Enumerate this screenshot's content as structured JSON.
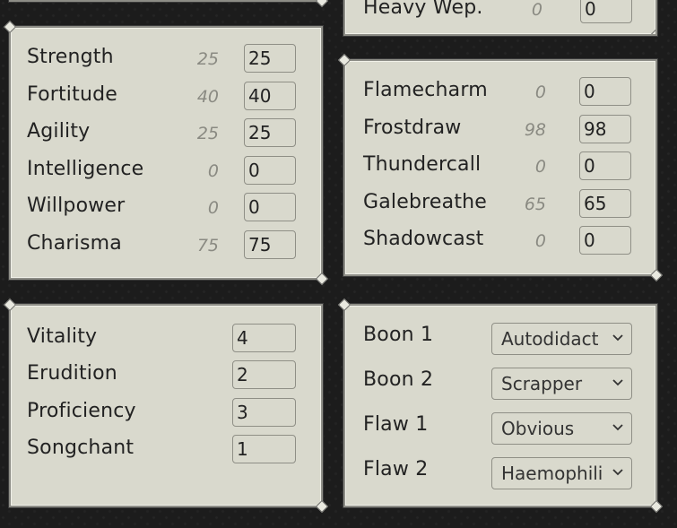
{
  "top_stub": {
    "label": "Heavy Wep.",
    "base": "0",
    "value": "0"
  },
  "attributes": [
    {
      "label": "Strength",
      "base": "25",
      "value": "25"
    },
    {
      "label": "Fortitude",
      "base": "40",
      "value": "40"
    },
    {
      "label": "Agility",
      "base": "25",
      "value": "25"
    },
    {
      "label": "Intelligence",
      "base": "0",
      "value": "0"
    },
    {
      "label": "Willpower",
      "base": "0",
      "value": "0"
    },
    {
      "label": "Charisma",
      "base": "75",
      "value": "75"
    }
  ],
  "elements": [
    {
      "label": "Flamecharm",
      "base": "0",
      "value": "0"
    },
    {
      "label": "Frostdraw",
      "base": "98",
      "value": "98"
    },
    {
      "label": "Thundercall",
      "base": "0",
      "value": "0"
    },
    {
      "label": "Galebreathe",
      "base": "65",
      "value": "65"
    },
    {
      "label": "Shadowcast",
      "base": "0",
      "value": "0"
    }
  ],
  "investments": [
    {
      "label": "Vitality",
      "value": "4"
    },
    {
      "label": "Erudition",
      "value": "2"
    },
    {
      "label": "Proficiency",
      "value": "3"
    },
    {
      "label": "Songchant",
      "value": "1"
    }
  ],
  "traits": [
    {
      "label": "Boon 1",
      "selected": "Autodidact"
    },
    {
      "label": "Boon 2",
      "selected": "Scrapper"
    },
    {
      "label": "Flaw 1",
      "selected": "Obvious"
    },
    {
      "label": "Flaw 2",
      "selected": "Haemophili"
    }
  ]
}
